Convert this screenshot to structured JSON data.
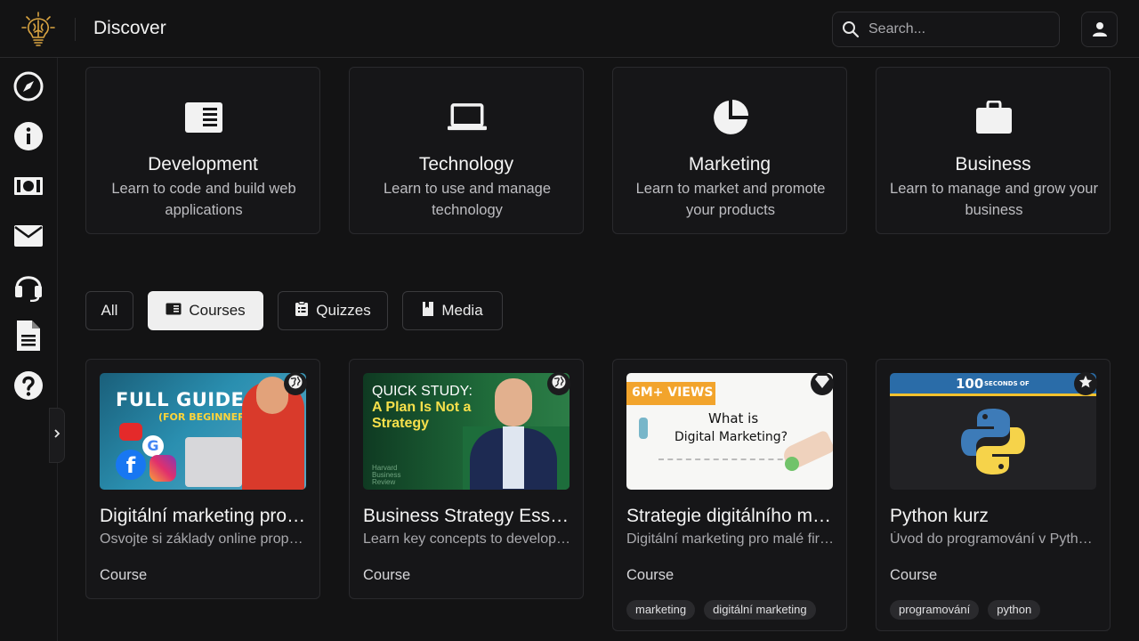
{
  "header": {
    "title": "Discover",
    "search_placeholder": "Search...",
    "logo_icon": "lightbulb-brain-icon",
    "user_icon": "user-icon"
  },
  "sidebar": {
    "items": [
      {
        "icon": "compass-icon"
      },
      {
        "icon": "info-icon"
      },
      {
        "icon": "money-icon"
      },
      {
        "icon": "mail-icon"
      },
      {
        "icon": "headset-icon"
      },
      {
        "icon": "document-icon"
      },
      {
        "icon": "help-icon"
      }
    ],
    "collapse_icon": "chevron-right-icon"
  },
  "categories": [
    {
      "title": "Development",
      "description": "Learn to code and build web applications",
      "icon": "newspaper-icon"
    },
    {
      "title": "Technology",
      "description": "Learn to use and manage technology",
      "icon": "laptop-icon"
    },
    {
      "title": "Marketing",
      "description": "Learn to market and promote your products",
      "icon": "pie-chart-icon"
    },
    {
      "title": "Business",
      "description": "Learn to manage and grow your business",
      "icon": "briefcase-icon"
    }
  ],
  "filters": [
    {
      "label": "All",
      "active": false
    },
    {
      "label": "Courses",
      "active": true,
      "icon": "newspaper-icon"
    },
    {
      "label": "Quizzes",
      "active": false,
      "icon": "clipboard-icon"
    },
    {
      "label": "Media",
      "active": false,
      "icon": "bookmark-icon"
    }
  ],
  "courses": [
    {
      "title": "Digitální marketing pro začátečníky",
      "description": "Osvojte si základy online propagace",
      "type": "Course",
      "badge_icon": "globe-icon",
      "thumbnail": {
        "line1": "FULL GUIDE",
        "line2": "(FOR BEGINNERS)"
      },
      "tags": []
    },
    {
      "title": "Business Strategy Essentials",
      "description": "Learn key concepts to develop a strategy",
      "type": "Course",
      "badge_icon": "globe-icon",
      "thumbnail": {
        "line1": "QUICK STUDY:",
        "line2": "A Plan Is Not a Strategy",
        "line3": "Harvard Business Review"
      },
      "tags": []
    },
    {
      "title": "Strategie digitálního marketingu",
      "description": "Digitální marketing pro malé firmy",
      "type": "Course",
      "badge_icon": "diamond-icon",
      "thumbnail": {
        "line1": "6M+ VIEWS",
        "line2": "What is",
        "line3": "Digital Marketing?"
      },
      "tags": [
        "marketing",
        "digitální marketing"
      ]
    },
    {
      "title": "Python kurz",
      "description": "Úvod do programování v Pythonu",
      "type": "Course",
      "badge_icon": "star-icon",
      "thumbnail": {
        "line1": "100",
        "line2": "SECONDS OF"
      },
      "tags": [
        "programování",
        "python"
      ]
    }
  ],
  "colors": {
    "background": "#131314",
    "card": "#161618",
    "border": "#2a2a2d",
    "accent_active": "#efefef",
    "logo_gold": "#d9a441"
  }
}
